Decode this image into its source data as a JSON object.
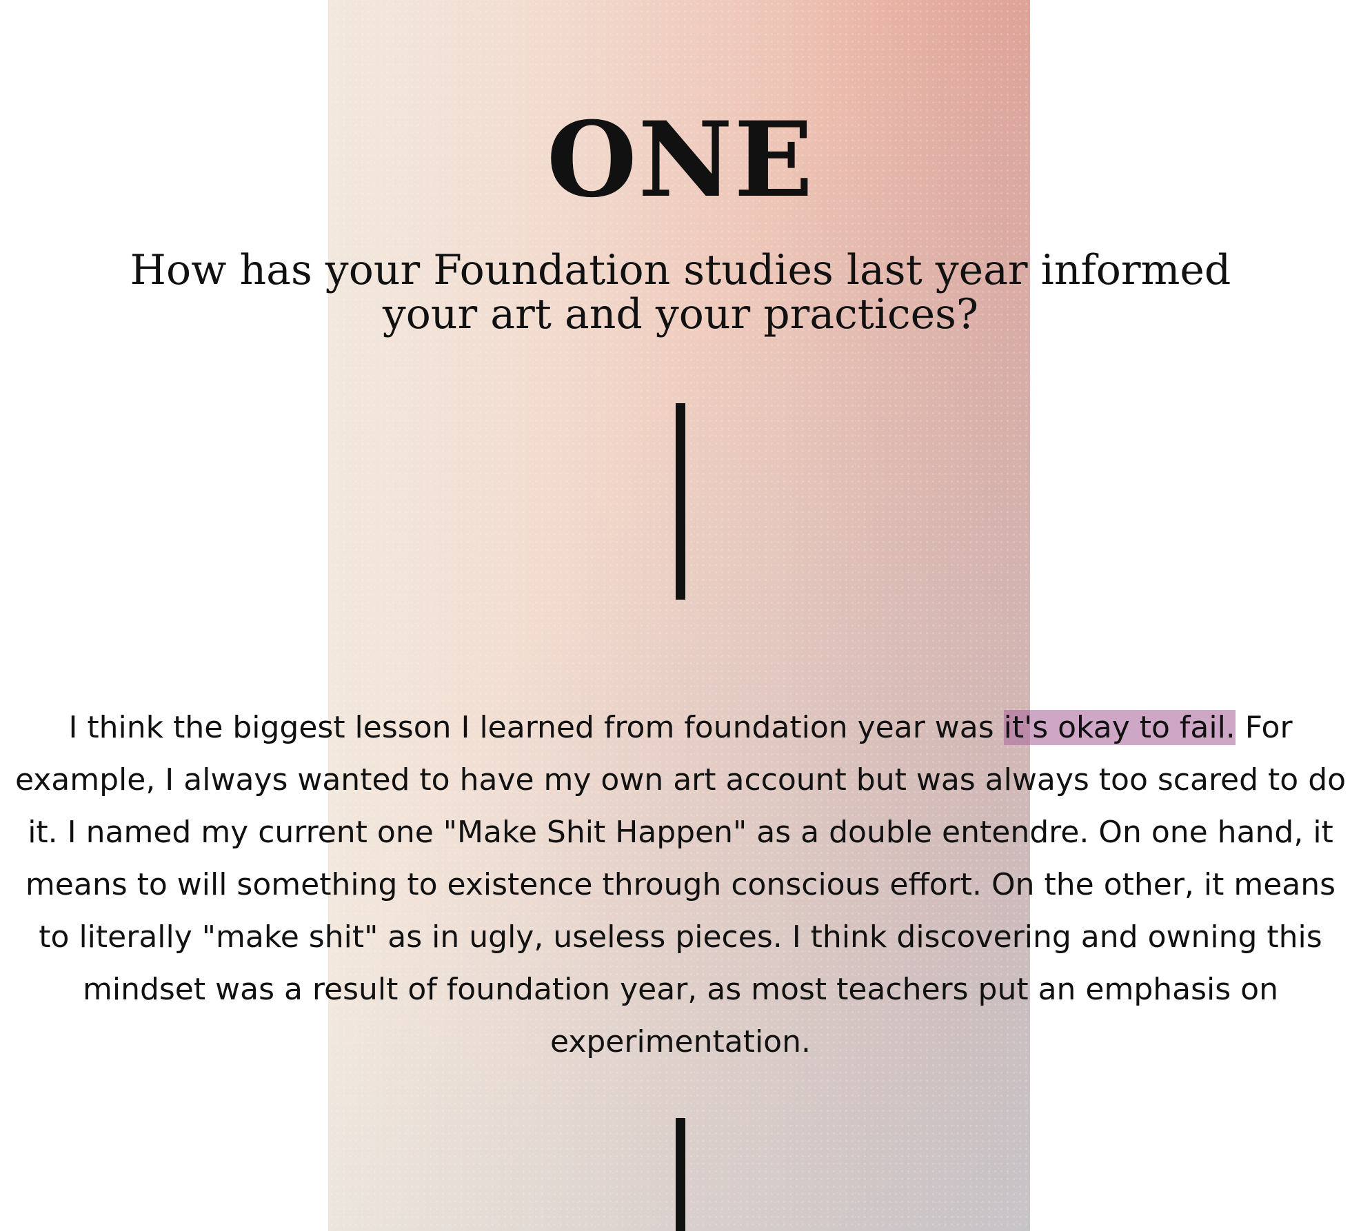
{
  "section": {
    "number_word": "ONE",
    "question": "How has your Foundation studies last year informed your art and your practices?"
  },
  "answer": {
    "before_highlight": "I think the biggest lesson I learned from foundation year was ",
    "highlight": "it's okay to fail.",
    "after_highlight": " For example, I always wanted to have my own art account but was always too scared to do it. I named my current one \"Make Shit Happen\" as a double entendre. On one hand, it means to will something to existence through conscious effort. On the other, it means to literally \"make shit\" as in ugly, useless pieces. I think discovering and owning this mindset was a result of foundation year, as most teachers put an emphasis on experimentation."
  },
  "colors": {
    "highlight": "#ae6ca0",
    "gradient_left": "#f2e8de",
    "gradient_right": "#e29c8f",
    "gradient_bottom_left": "#bed2dc",
    "text": "#111111"
  }
}
